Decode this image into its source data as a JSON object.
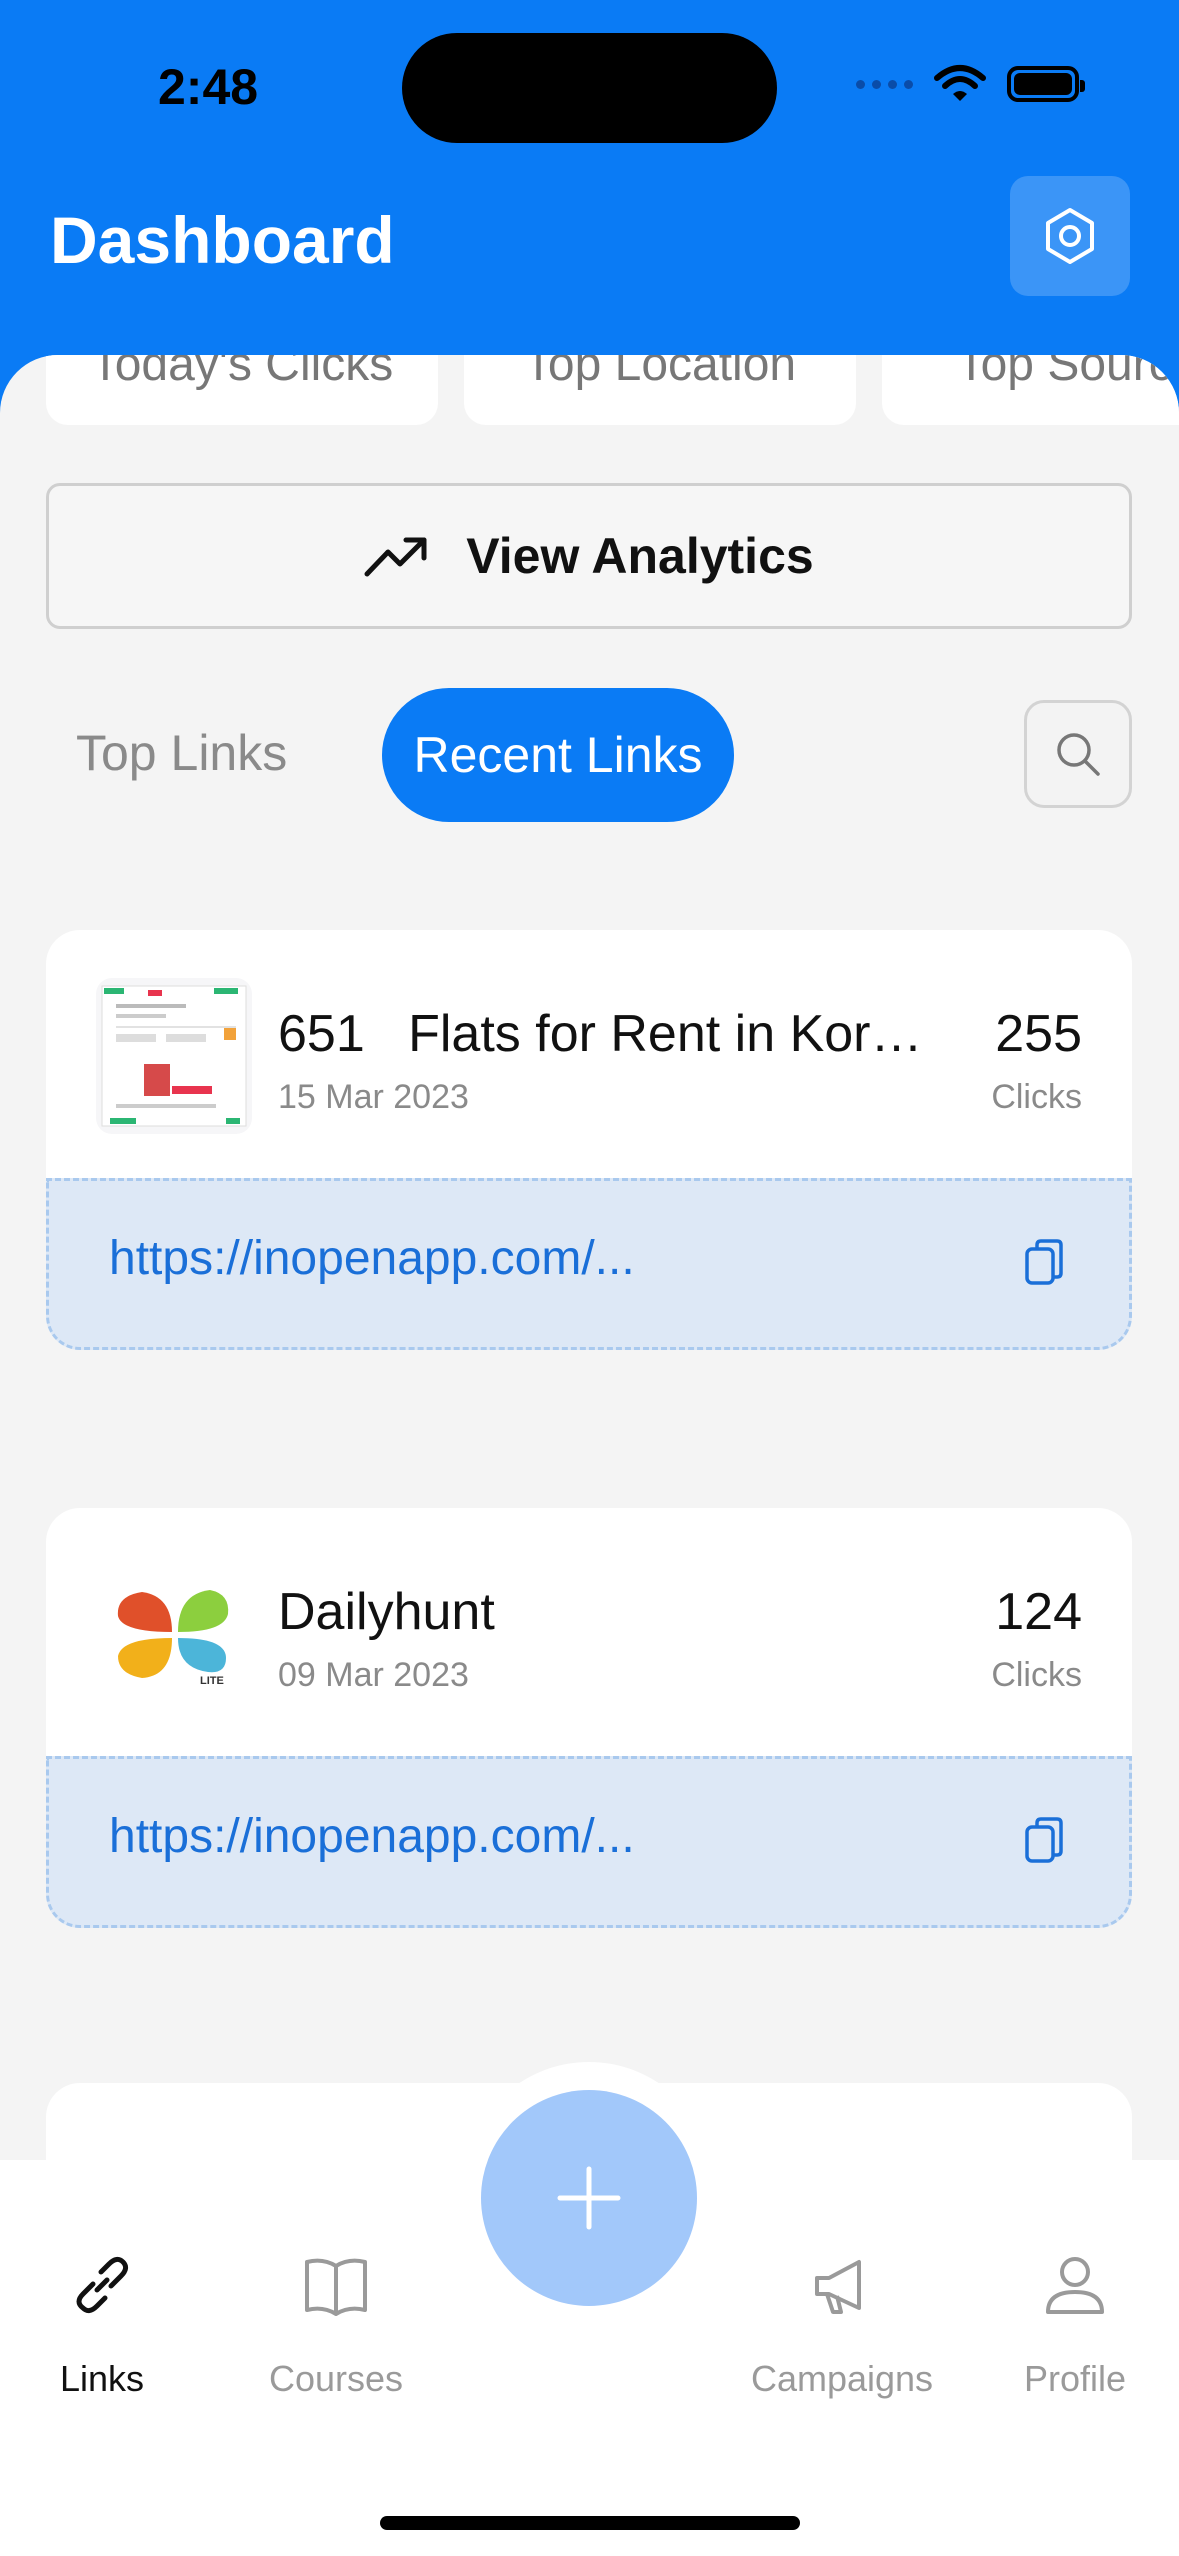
{
  "status": {
    "time": "2:48"
  },
  "header": {
    "title": "Dashboard"
  },
  "stats": [
    {
      "label": "Today's Clicks"
    },
    {
      "label": "Top Location"
    },
    {
      "label": "Top Source"
    }
  ],
  "analytics_button": {
    "label": "View Analytics"
  },
  "tabs": {
    "top": "Top Links",
    "recent": "Recent Links",
    "active": "Recent Links"
  },
  "links": [
    {
      "number": "651",
      "title": "Flats for Rent in Korma...",
      "date": "15 Mar 2023",
      "clicks": "255",
      "clicks_label": "Clicks",
      "url": "https://inopenapp.com/..."
    },
    {
      "number": "",
      "title": "Dailyhunt",
      "date": "09 Mar 2023",
      "clicks": "124",
      "clicks_label": "Clicks",
      "url": "https://inopenapp.com/..."
    }
  ],
  "colors": {
    "primary": "#0a7bf5",
    "fab": "#a2c8fa",
    "url_bg": "#dde8f6",
    "url_text": "#1a6fd8"
  },
  "tabbar": {
    "items": [
      {
        "label": "Links",
        "icon": "link-icon",
        "active": true
      },
      {
        "label": "Courses",
        "icon": "book-icon",
        "active": false
      },
      {
        "label": "Campaigns",
        "icon": "megaphone-icon",
        "active": false
      },
      {
        "label": "Profile",
        "icon": "user-icon",
        "active": false
      }
    ],
    "fab_icon": "plus-icon"
  }
}
